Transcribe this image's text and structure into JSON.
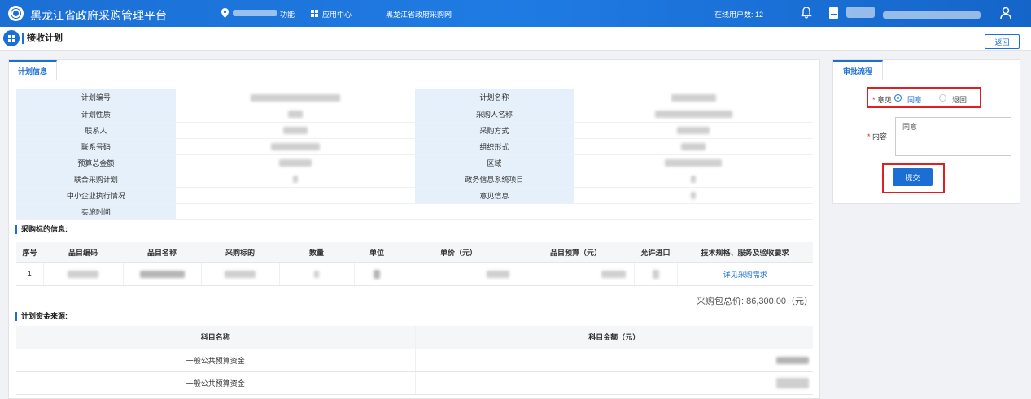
{
  "app": {
    "title": "黑龙江省政府采购管理平台"
  },
  "topnav": {
    "location_suffix": "功能",
    "app_center": "应用中心",
    "gov_site": "黑龙江省政府采购网",
    "online_label": "在线用户数: 12"
  },
  "page": {
    "title": "接收计划",
    "back_label": "返回"
  },
  "main_tab": "计划信息",
  "info_rows": [
    [
      "计划编号",
      "计划名称"
    ],
    [
      "计划性质",
      "采购人名称"
    ],
    [
      "联系人",
      "采购方式"
    ],
    [
      "联系号码",
      "组织形式"
    ],
    [
      "预算总金额",
      "区域"
    ],
    [
      "联合采购计划",
      "政务信息系统项目"
    ],
    [
      "中小企业执行情况",
      "意见信息"
    ],
    [
      "实施时间",
      ""
    ]
  ],
  "items_section": "采购标的信息:",
  "items_headers": [
    "序号",
    "品目编码",
    "品目名称",
    "采购标的",
    "数量",
    "单位",
    "单价（元）",
    "品目预算（元）",
    "允许进口",
    "技术规格、服务及验收要求"
  ],
  "items_rows": [
    {
      "index": "1",
      "detail_link": "详见采购需求"
    }
  ],
  "total_label": "采购包总价: 86,300.00（元）",
  "fund_section": "计划资金来源:",
  "fund_headers": [
    "科目名称",
    "科目金额（元）"
  ],
  "fund_rows": [
    {
      "name": "一般公共预算资金"
    },
    {
      "name": "一般公共预算资金"
    }
  ],
  "approval": {
    "tab": "审批流程",
    "opinion_label": "意见",
    "opinion_options": [
      "同意",
      "退回"
    ],
    "selected": "同意",
    "content_label": "内容",
    "content_value": "同意",
    "submit_label": "提交"
  },
  "colors": {
    "primary": "#1b6fd4",
    "highlight_box": "#e02020",
    "label_bg": "#e6f0fb"
  }
}
